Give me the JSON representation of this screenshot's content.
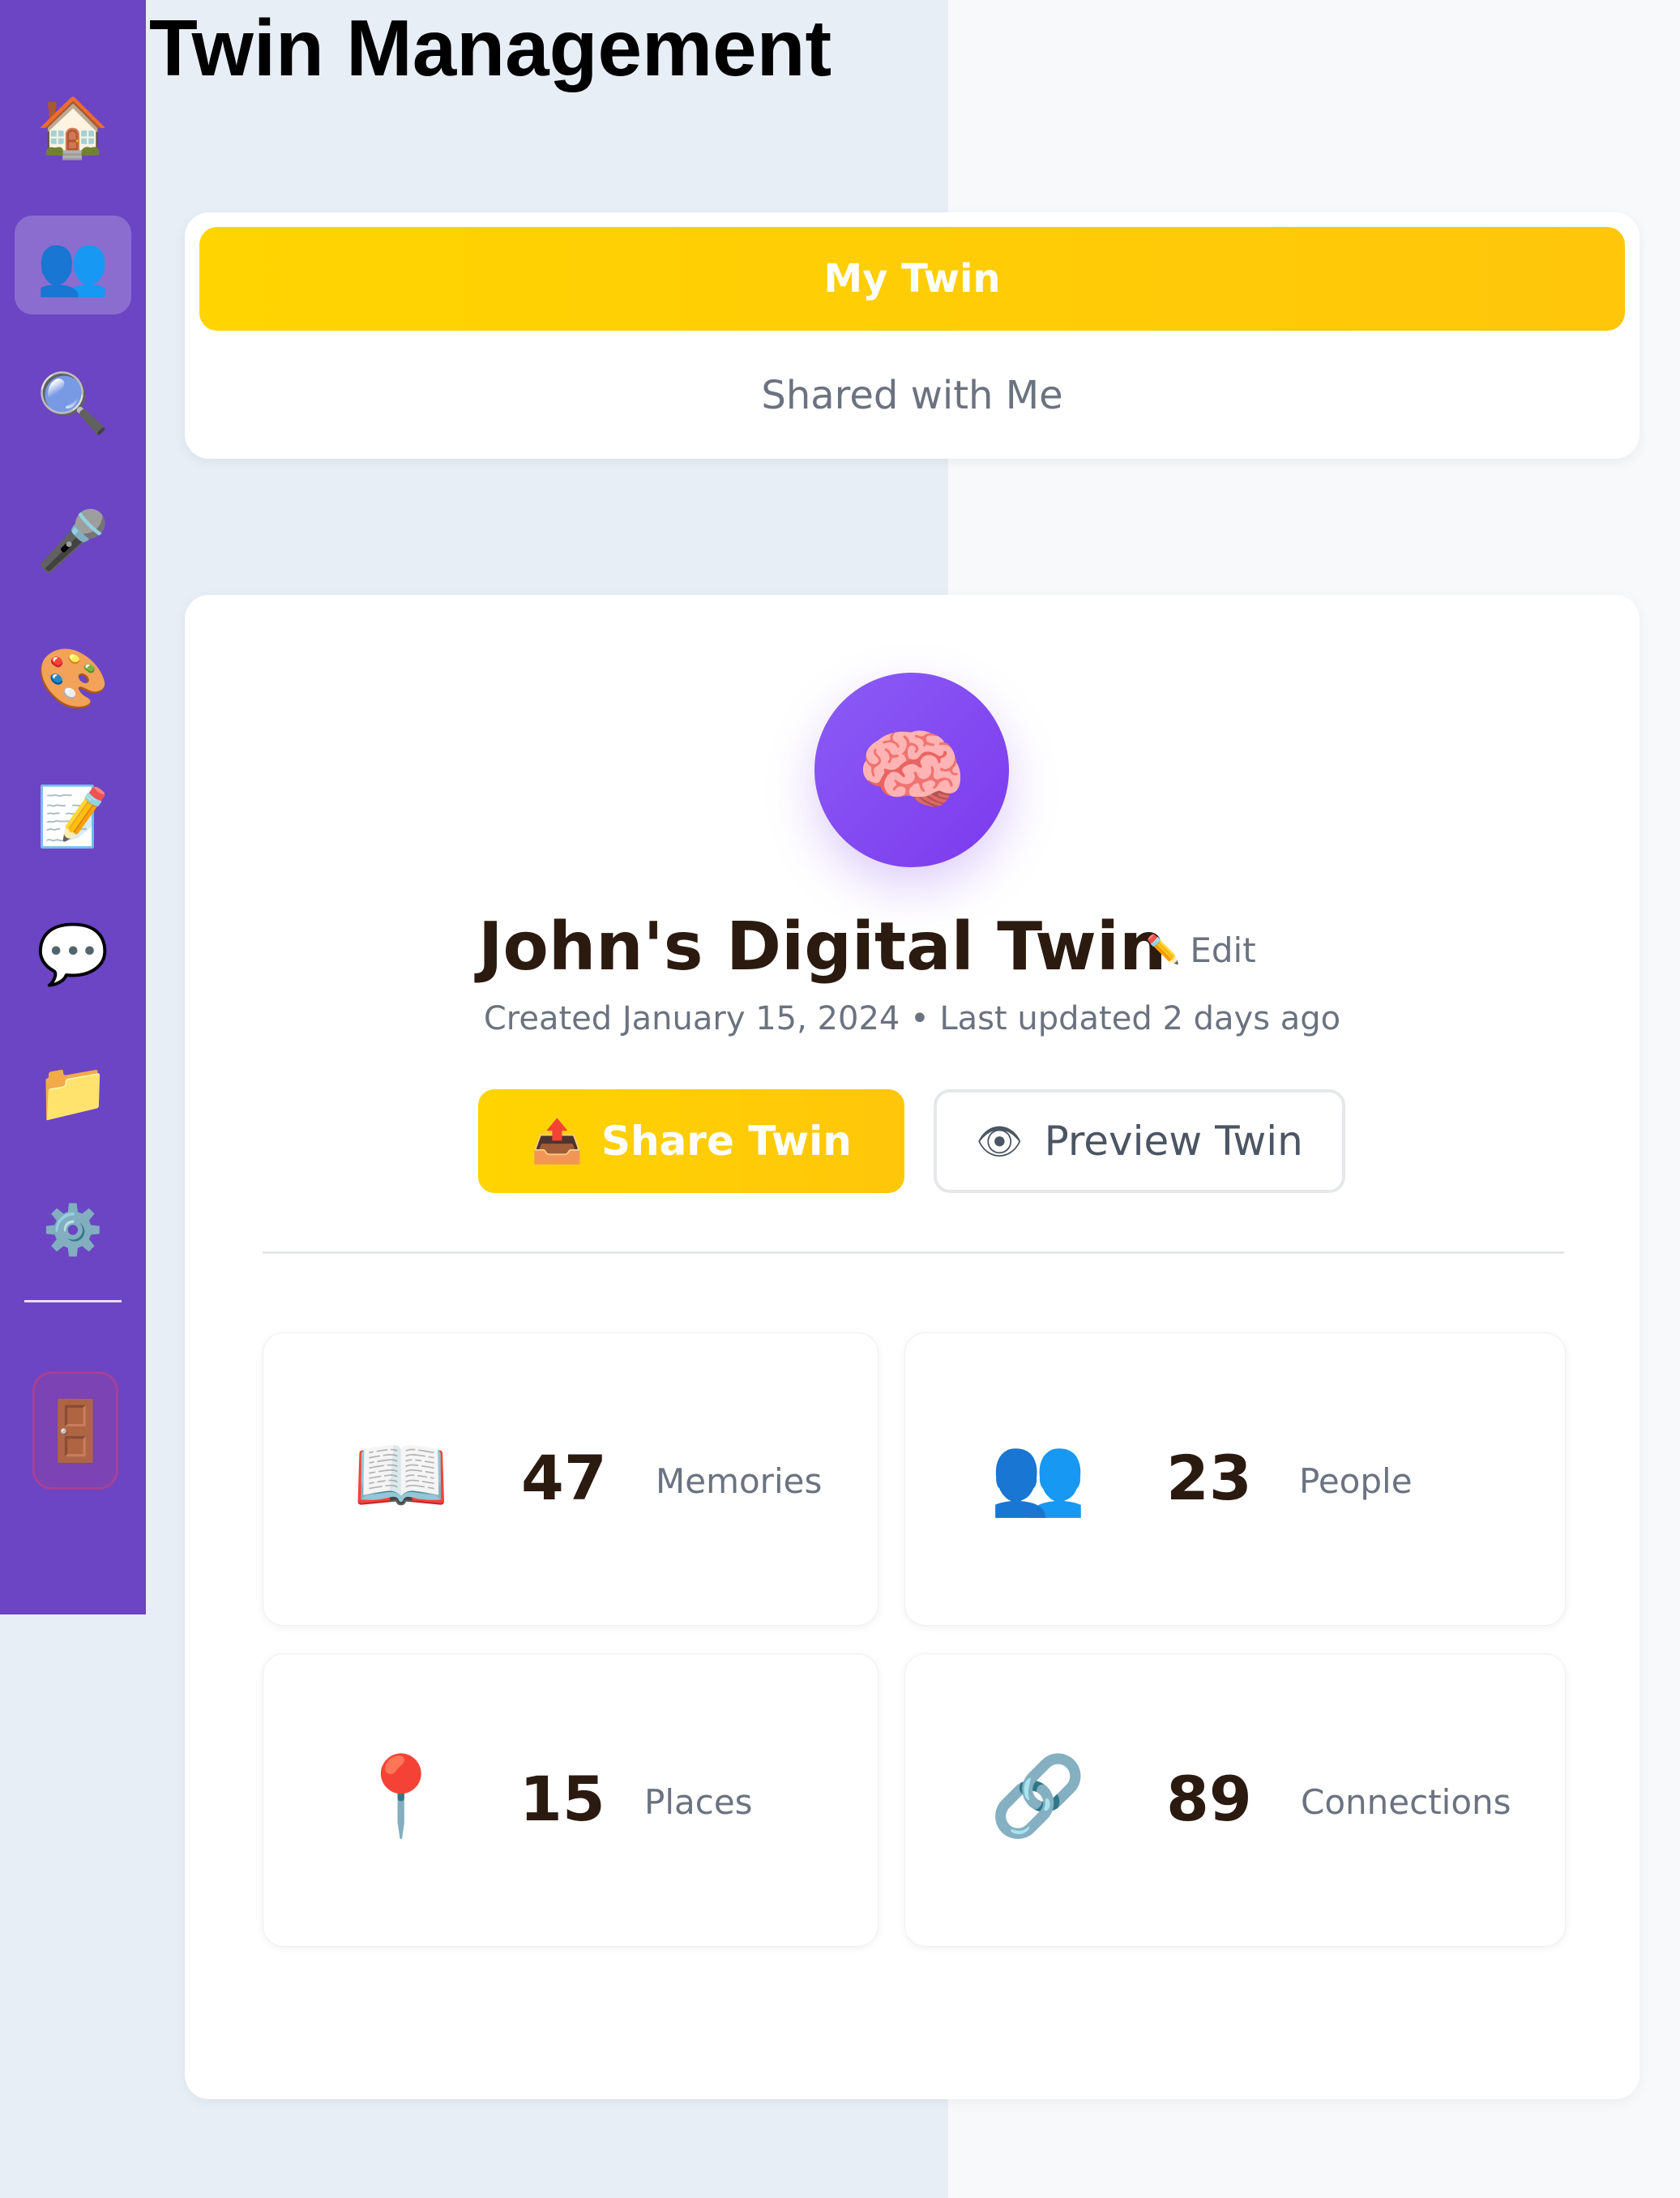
{
  "page": {
    "title": "Twin Management"
  },
  "sidebar": {
    "items": [
      {
        "name": "home",
        "icon": "🏠"
      },
      {
        "name": "twins",
        "icon": "👥",
        "active": true
      },
      {
        "name": "search",
        "icon": "🔍"
      },
      {
        "name": "record",
        "icon": "🎤"
      },
      {
        "name": "create",
        "icon": "🎨"
      },
      {
        "name": "notes",
        "icon": "📝"
      },
      {
        "name": "chat",
        "icon": "💬"
      },
      {
        "name": "files",
        "icon": "📁"
      },
      {
        "name": "settings",
        "icon": "⚙️"
      }
    ],
    "logout_icon": "🚪"
  },
  "tabs": {
    "active": "My Twin",
    "inactive": "Shared with Me"
  },
  "profile": {
    "avatar_icon": "🧠",
    "name": "John's Digital Twin",
    "edit_icon": "✏️",
    "edit_label": "Edit",
    "meta": "Created January 15, 2024 • Last updated 2 days ago",
    "share_icon": "📤",
    "share_label": "Share Twin",
    "preview_icon": "👁",
    "preview_label": "Preview Twin"
  },
  "stats": [
    {
      "icon": "📖",
      "value": "47",
      "label": "Memories"
    },
    {
      "icon": "👥",
      "value": "23",
      "label": "People"
    },
    {
      "icon": "📍",
      "value": "15",
      "label": "Places"
    },
    {
      "icon": "🔗",
      "value": "89",
      "label": "Connections"
    }
  ],
  "colors": {
    "sidebar": "#6b45c3",
    "accent": "#ffc60a",
    "avatar": "#7c3aed"
  }
}
